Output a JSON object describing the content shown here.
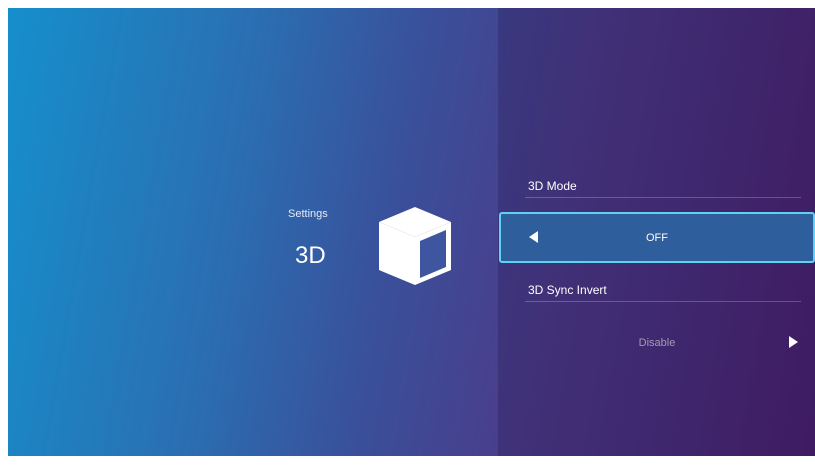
{
  "header": {
    "category": "Settings",
    "title": "3D",
    "icon": "cube-icon"
  },
  "options": [
    {
      "label": "3D Mode",
      "value": "OFF",
      "selected": true
    },
    {
      "label": "3D Sync Invert",
      "value": "Disable",
      "selected": false
    }
  ],
  "colors": {
    "accent_border": "#5fd2f0",
    "selected_fill": "#2f5e9c"
  }
}
